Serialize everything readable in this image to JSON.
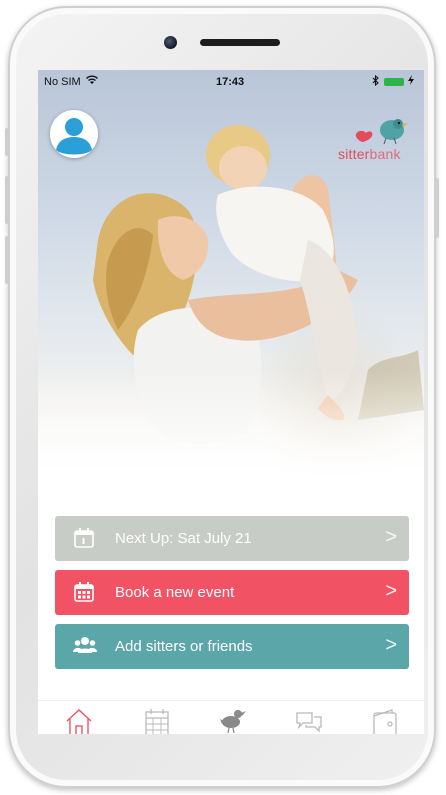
{
  "status_bar": {
    "carrier": "No SIM",
    "time": "17:43"
  },
  "logo": {
    "word_part1": "sitter",
    "word_part2": "bank"
  },
  "actions": {
    "next_up": "Next Up: Sat July 21",
    "book": "Book a new event",
    "add": "Add sitters or friends",
    "chevron": ">"
  },
  "colors": {
    "next_up_bg": "#c8ccc6",
    "book_bg": "#f25364",
    "add_bg": "#5aa6a9",
    "brand_red": "#e24b5c",
    "avatar_blue": "#2a9fd8",
    "tab_active": "#f25364",
    "tab_inactive": "#b9b9b9"
  },
  "icons": {
    "avatar": "user-silhouette-icon",
    "next_up": "calendar-day-icon",
    "book": "calendar-grid-icon",
    "add": "users-group-icon",
    "tabs": [
      "home-icon",
      "calendar-icon",
      "bird-icon",
      "chat-icon",
      "wallet-icon"
    ]
  }
}
